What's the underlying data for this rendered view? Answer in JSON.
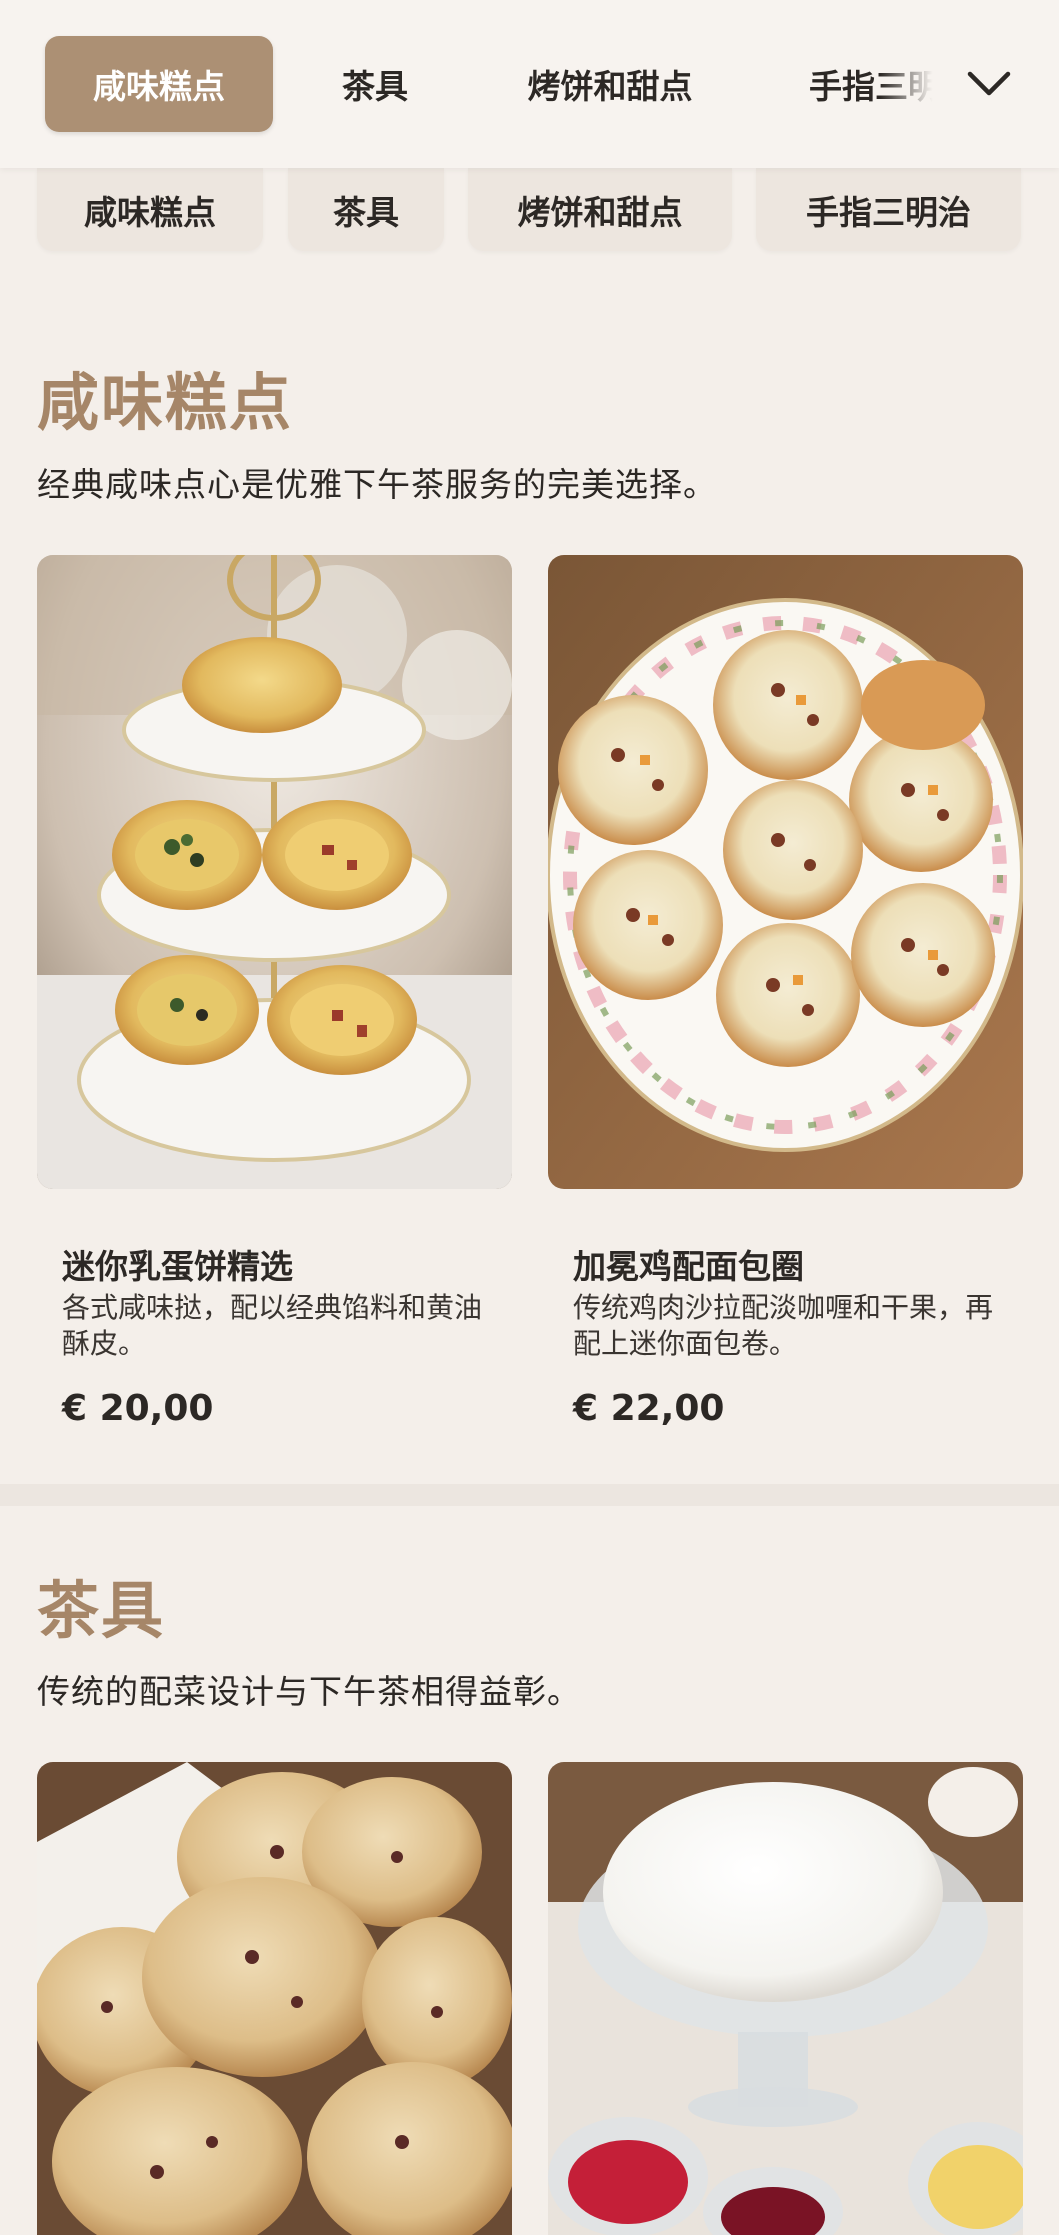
{
  "nav": {
    "tabs": [
      {
        "label": "咸味糕点",
        "active": true
      },
      {
        "label": "茶具",
        "active": false
      },
      {
        "label": "烤饼和甜点",
        "active": false
      },
      {
        "label": "手指三明治",
        "active": false
      }
    ],
    "more_icon": "chevron-down-icon"
  },
  "categories": [
    "咸味糕点",
    "茶具",
    "烤饼和甜点",
    "手指三明治"
  ],
  "sections": [
    {
      "title": "咸味糕点",
      "subtitle": "经典咸味点心是优雅下午茶服务的完美选择。",
      "items": [
        {
          "name": "迷你乳蛋饼精选",
          "description": "各式咸味挞，配以经典馅料和黄油酥皮。",
          "price": "€ 20,00"
        },
        {
          "name": "加冕鸡配面包圈",
          "description": "传统鸡肉沙拉配淡咖喱和干果，再配上迷你面包卷。",
          "price": "€ 22,00"
        }
      ]
    },
    {
      "title": "茶具",
      "subtitle": "传统的配菜设计与下午茶相得益彰。",
      "items": []
    }
  ],
  "colors": {
    "accent": "#ac9074",
    "section_title": "#a68668",
    "background": "#f4efea",
    "text": "#2c2825"
  }
}
